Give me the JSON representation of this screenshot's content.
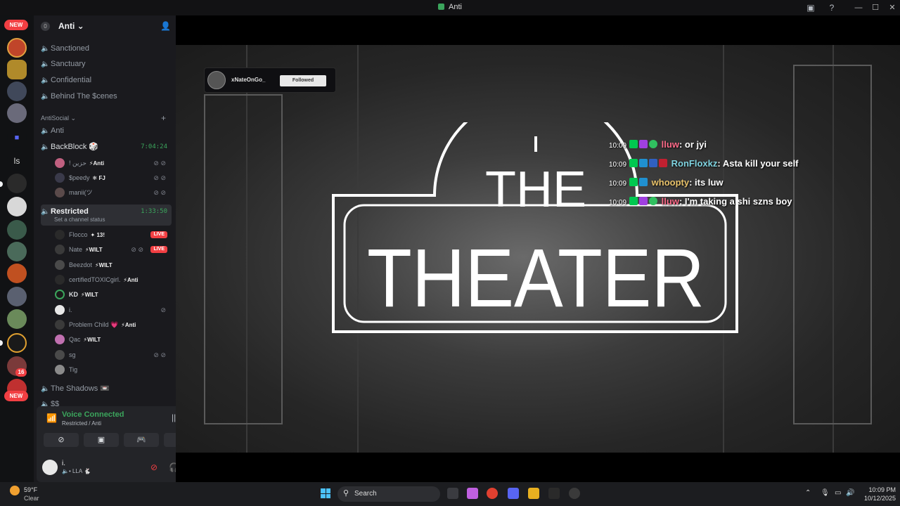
{
  "window": {
    "title": "Anti"
  },
  "servers": {
    "new_badge": "NEW",
    "ls_label": "ls",
    "notif_count": "16",
    "new_badge_bottom": "NEW"
  },
  "guild": {
    "name": "Anti",
    "level": "0"
  },
  "channels": {
    "top": [
      {
        "label": "Sanctioned"
      },
      {
        "label": "Sanctuary"
      },
      {
        "label": "Confidential"
      },
      {
        "label": "Behind The $cenes"
      }
    ],
    "category": "AntiSocial",
    "anti": "Anti",
    "backblock": {
      "label": "BackBlock",
      "emoji": "🎲",
      "time": "7:04:24"
    },
    "backblock_members": [
      {
        "name": "! حزين",
        "tag": "⚡Anti"
      },
      {
        "name": "$peedy",
        "tag": "❄ FJ"
      },
      {
        "name": "manii(ツ",
        "tag": ""
      }
    ],
    "restricted": {
      "label": "Restricted",
      "time": "1:33:50",
      "status_hint": "Set a channel status"
    },
    "restricted_members": [
      {
        "name": "Flocco",
        "tag": "✦ 13!",
        "live": "LIVE"
      },
      {
        "name": "Nate",
        "tag": "⚡WILT",
        "live": "LIVE"
      },
      {
        "name": "Beezdot",
        "tag": "⚡WILT",
        "live": ""
      },
      {
        "name": "certifiedTOXICgirl.",
        "tag": "⚡Anti",
        "live": ""
      },
      {
        "name": "KD",
        "tag": "⚡WILT",
        "live": ""
      },
      {
        "name": "i.",
        "tag": "",
        "live": ""
      },
      {
        "name": "Problem Child 💗",
        "tag": "⚡Anti",
        "live": ""
      },
      {
        "name": "Qac",
        "tag": "⚡WILT",
        "live": ""
      },
      {
        "name": "sg",
        "tag": "",
        "live": ""
      },
      {
        "name": "Tig",
        "tag": "",
        "live": ""
      }
    ],
    "shadows": {
      "label": "The Shadows",
      "emoji": "📼"
    },
    "cut_off": "$$"
  },
  "voice": {
    "status": "Voice Connected",
    "location": "Restricted / Anti"
  },
  "user": {
    "name": "i.",
    "status": "🔈• LLA 🐇"
  },
  "stream": {
    "streamer": "xNateOnGo_",
    "follow_label": "Followed",
    "chat": [
      {
        "time": "10:09",
        "user": "lluw",
        "color": "#ff6b8a",
        "text": "or jyi"
      },
      {
        "time": "10:09",
        "user": "RonFloxkz",
        "color": "#7fd3e0",
        "text": "Asta kill your self"
      },
      {
        "time": "10:09",
        "user": "whoopty",
        "color": "#e8c26a",
        "text": "its luw"
      },
      {
        "time": "10:09",
        "user": "lluw",
        "color": "#ff6b8a",
        "text": "I'm taking a shi szns boy"
      }
    ],
    "logo_top": "THE",
    "logo_main": "THEATER"
  },
  "taskbar": {
    "weather_temp": "59°F",
    "weather_cond": "Clear",
    "search_label": "Search",
    "time": "10:09 PM",
    "date": "10/12/2025"
  }
}
